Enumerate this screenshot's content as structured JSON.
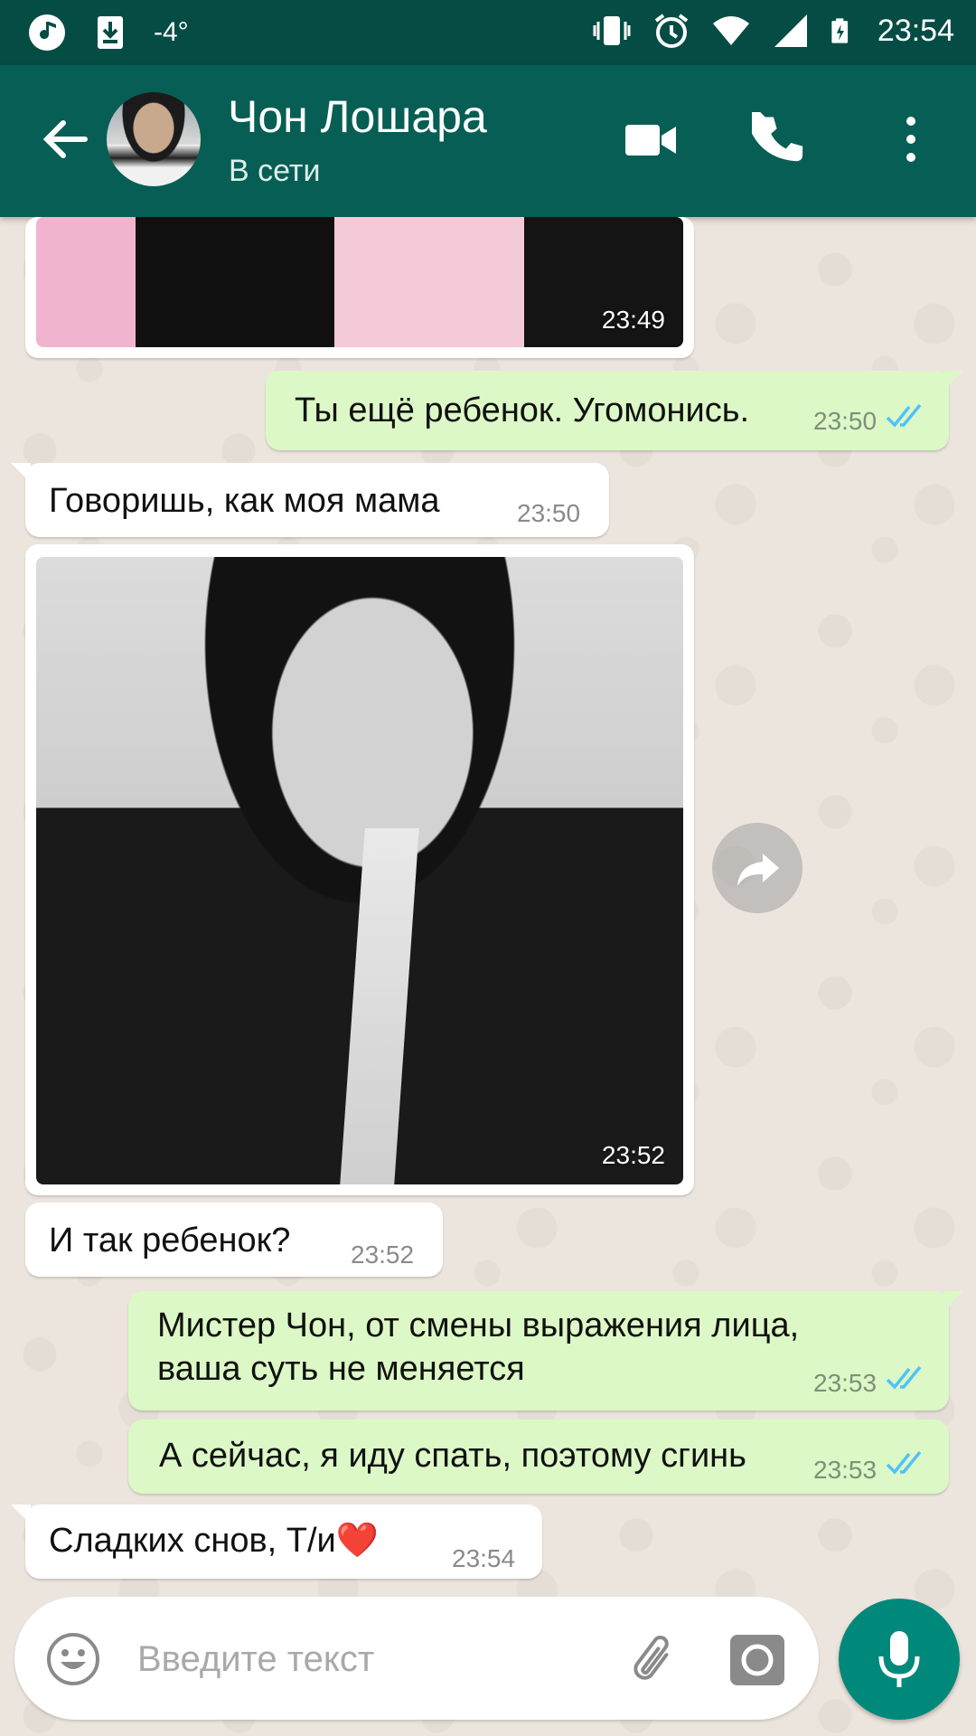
{
  "status_bar": {
    "temperature": "-4°",
    "time": "23:54",
    "icons": [
      "music-note-icon",
      "download-icon",
      "vibrate-icon",
      "alarm-icon",
      "wifi-icon",
      "signal-icon",
      "battery-charging-icon"
    ]
  },
  "header": {
    "contact_name": "Чон Лошара",
    "status": "В сети",
    "actions": [
      "back-arrow-icon",
      "video-call-icon",
      "phone-icon",
      "more-vert-icon"
    ],
    "colors": {
      "status_bar": "#054d44",
      "app_bar": "#075e54"
    }
  },
  "messages": [
    {
      "direction": "in",
      "type": "image",
      "time": "23:49"
    },
    {
      "direction": "out",
      "type": "text",
      "text": "Ты ещё ребенок. Угомонись.",
      "time": "23:50",
      "read": true
    },
    {
      "direction": "in",
      "type": "text",
      "text": "Говоришь, как моя мама",
      "time": "23:50"
    },
    {
      "direction": "in",
      "type": "image",
      "time": "23:52"
    },
    {
      "direction": "in",
      "type": "text",
      "text": "И так ребенок?",
      "time": "23:52"
    },
    {
      "direction": "out",
      "type": "text",
      "lines": [
        "Мистер Чон, от смены выражения лица,",
        "ваша суть не меняется"
      ],
      "time": "23:53",
      "read": true
    },
    {
      "direction": "out",
      "type": "text",
      "text": "А сейчас, я иду спать, поэтому сгинь",
      "time": "23:53",
      "read": true
    },
    {
      "direction": "in",
      "type": "text",
      "text": "Сладких снов, Т/и❤️",
      "time": "23:54"
    }
  ],
  "composer": {
    "placeholder": "Введите текст",
    "icons": [
      "emoji-icon",
      "attach-icon",
      "camera-icon",
      "mic-icon"
    ],
    "accent": "#00897b"
  },
  "colors": {
    "incoming": "#ffffff",
    "outgoing": "#dcf8c6",
    "read_ticks": "#4fc3f7",
    "wallpaper": "#ece5dd"
  }
}
